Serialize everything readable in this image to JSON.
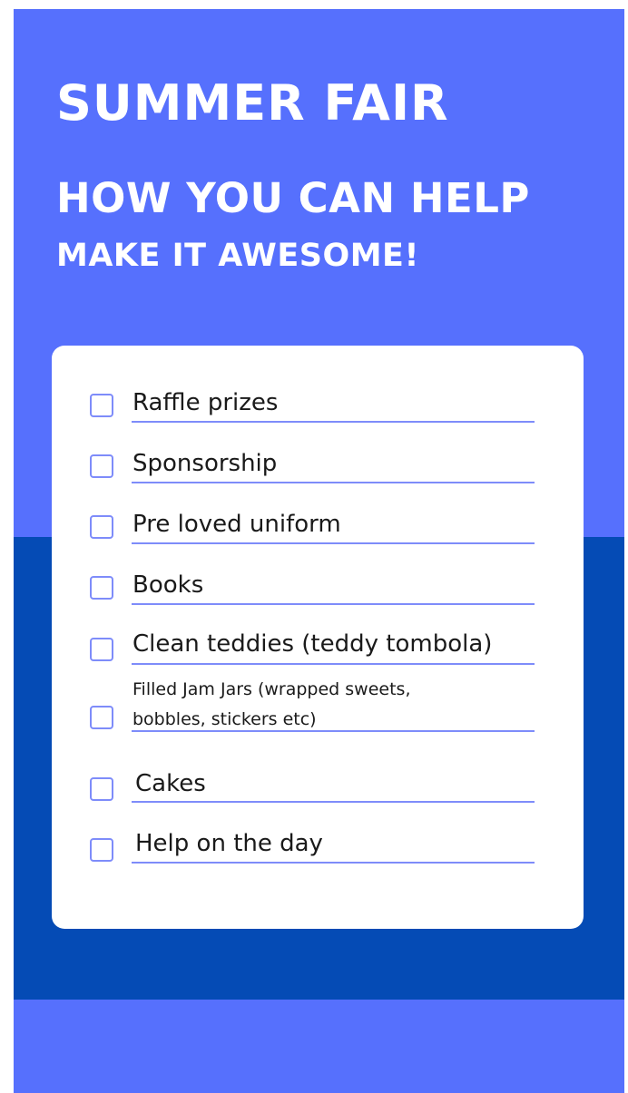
{
  "colors": {
    "light_blue": "#5670fd",
    "dark_blue": "#054bb5",
    "line_blue": "#7e8cfa"
  },
  "poster": {
    "title": "SUMMER FAIR",
    "subtitle": "HOW YOU CAN HELP",
    "tagline": "MAKE IT AWESOME!"
  },
  "checklist": {
    "items": [
      {
        "label": "Raffle prizes",
        "checked": false
      },
      {
        "label": "Sponsorship",
        "checked": false
      },
      {
        "label": "Pre loved uniform",
        "checked": false
      },
      {
        "label": "Books",
        "checked": false
      },
      {
        "label": "Clean teddies (teddy  tombola)",
        "checked": false
      },
      {
        "label_line1": "Filled Jam Jars (wrapped sweets,",
        "label_line2": "bobbles, stickers etc)",
        "checked": false
      },
      {
        "label": "Cakes",
        "checked": false
      },
      {
        "label": "Help on the day",
        "checked": false
      }
    ]
  }
}
